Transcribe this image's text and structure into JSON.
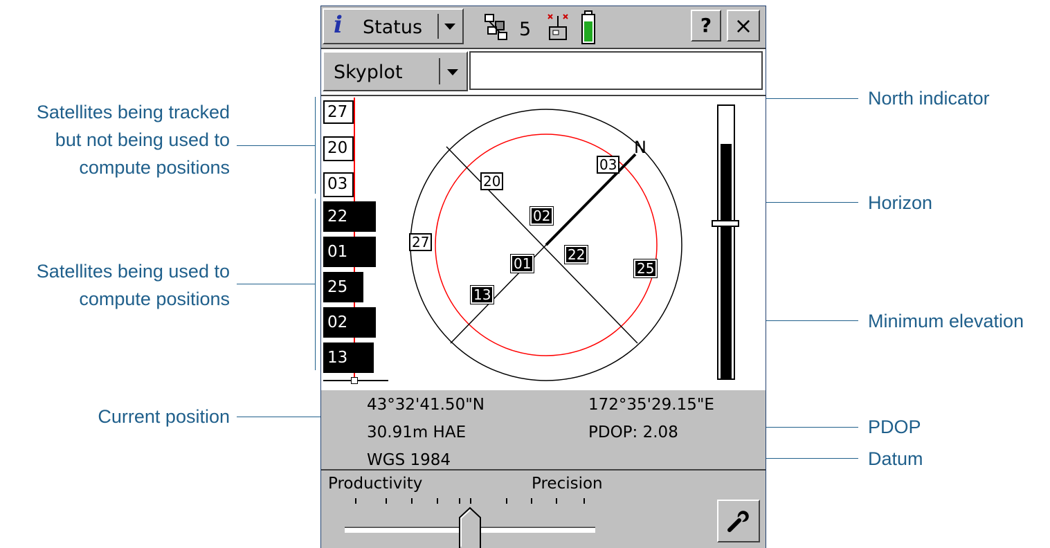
{
  "toolbar": {
    "status_label": "Status",
    "satellite_count": "5",
    "help_label": "?",
    "close_label": "×"
  },
  "view_selector": {
    "selected": "Skyplot"
  },
  "skyplot": {
    "north_label": "N",
    "tracked_not_used": [
      "27",
      "20",
      "03"
    ],
    "used": [
      {
        "id": "22",
        "signal": 0.82
      },
      {
        "id": "01",
        "signal": 0.82
      },
      {
        "id": "25",
        "signal": 0.63
      },
      {
        "id": "02",
        "signal": 0.82
      },
      {
        "id": "13",
        "signal": 0.79
      }
    ],
    "plot_labels": [
      {
        "id": "03",
        "used": false
      },
      {
        "id": "20",
        "used": false
      },
      {
        "id": "27",
        "used": false
      },
      {
        "id": "02",
        "used": true
      },
      {
        "id": "22",
        "used": true
      },
      {
        "id": "01",
        "used": true
      },
      {
        "id": "25",
        "used": true
      },
      {
        "id": "13",
        "used": true
      }
    ],
    "elevation_mask_level": 0.58,
    "pdop_bar_level": 0.86
  },
  "position": {
    "latitude": "43°32'41.50\"N",
    "longitude": "172°35'29.15\"E",
    "height": "30.91m HAE",
    "pdop": "PDOP: 2.08",
    "datum": "WGS 1984"
  },
  "precision_slider": {
    "left_label": "Productivity",
    "right_label": "Precision",
    "value": 0.5
  },
  "callouts": {
    "tracked_line1": "Satellites being tracked",
    "tracked_line2": "but not being used to",
    "tracked_line3": "compute positions",
    "used_line1": "Satellites being used to",
    "used_line2": "compute positions",
    "current_position": "Current position",
    "north_indicator": "North indicator",
    "horizon": "Horizon",
    "minimum_elevation": "Minimum elevation",
    "pdop": "PDOP",
    "datum": "Datum"
  },
  "colors": {
    "callout_text": "#1f5f8b",
    "elevation_mask_circle": "#ff0000",
    "device_gray": "#c0c0c0",
    "status_icon": "#2233aa",
    "battery_green": "#22aa22"
  }
}
